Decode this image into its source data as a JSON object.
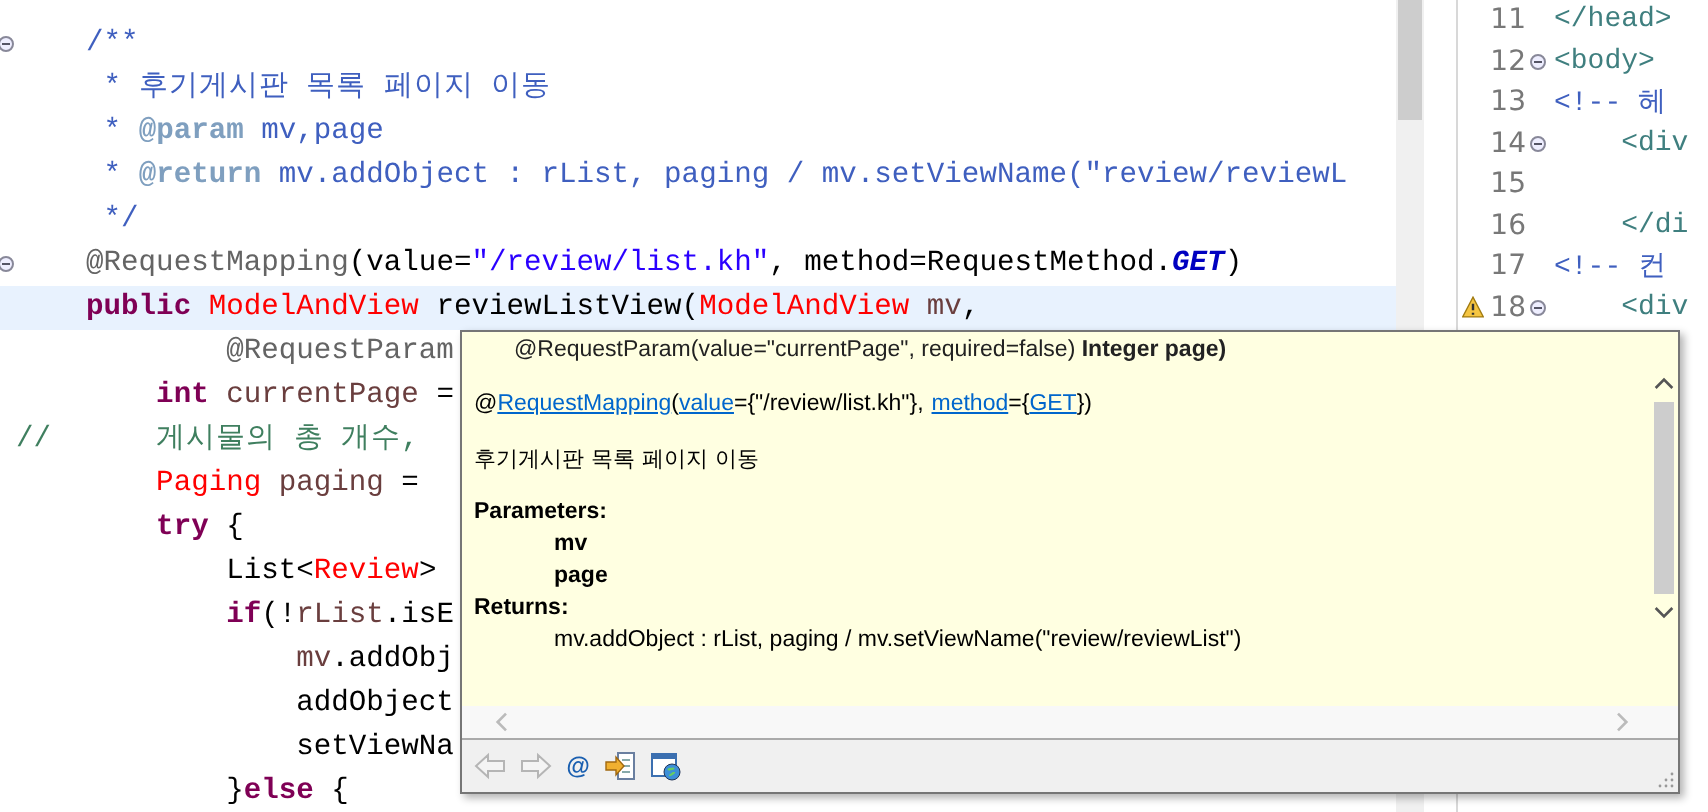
{
  "editor": {
    "lines": [
      {
        "fold": true,
        "current": false,
        "segments": [
          {
            "kind": "doc",
            "text": "    /**"
          }
        ]
      },
      {
        "fold": false,
        "current": false,
        "segments": [
          {
            "kind": "doc",
            "text": "     * 후기게시판 목록 페이지 이동"
          }
        ]
      },
      {
        "fold": false,
        "current": false,
        "segments": [
          {
            "kind": "doc",
            "text": "     * "
          },
          {
            "kind": "doctag",
            "text": "@param"
          },
          {
            "kind": "doc",
            "text": " mv,page"
          }
        ]
      },
      {
        "fold": false,
        "current": false,
        "segments": [
          {
            "kind": "doc",
            "text": "     * "
          },
          {
            "kind": "doctag",
            "text": "@return"
          },
          {
            "kind": "doc",
            "text": " mv.addObject : rList, paging / mv.setViewName(\"review/reviewL"
          }
        ]
      },
      {
        "fold": false,
        "current": false,
        "segments": [
          {
            "kind": "doc",
            "text": "     */"
          }
        ]
      },
      {
        "fold": true,
        "current": false,
        "segments": [
          {
            "kind": "annotation",
            "text": "    @RequestMapping"
          },
          {
            "kind": "plain",
            "text": "(value="
          },
          {
            "kind": "string",
            "text": "\"/review/list.kh\""
          },
          {
            "kind": "plain",
            "text": ", method=RequestMethod."
          },
          {
            "kind": "constant",
            "text": "GET"
          },
          {
            "kind": "plain",
            "text": ")"
          }
        ]
      },
      {
        "fold": false,
        "current": true,
        "segments": [
          {
            "kind": "keyword",
            "text": "    public"
          },
          {
            "kind": "type",
            "text": " ModelAndView"
          },
          {
            "kind": "plain",
            "text": " reviewListView("
          },
          {
            "kind": "type",
            "text": "ModelAndView"
          },
          {
            "kind": "var",
            "text": " mv"
          },
          {
            "kind": "plain",
            "text": ","
          }
        ]
      },
      {
        "fold": false,
        "current": false,
        "segments": [
          {
            "kind": "annotation",
            "text": "            @RequestParam"
          }
        ]
      },
      {
        "fold": false,
        "current": false,
        "segments": [
          {
            "kind": "keyword",
            "text": "        int"
          },
          {
            "kind": "var",
            "text": " currentPage"
          },
          {
            "kind": "plain",
            "text": " ="
          }
        ]
      },
      {
        "fold": false,
        "current": false,
        "segments": [
          {
            "kind": "comment",
            "text": "//      게시물의 총 개수,"
          }
        ]
      },
      {
        "fold": false,
        "current": false,
        "segments": [
          {
            "kind": "type",
            "text": "        Paging"
          },
          {
            "kind": "var",
            "text": " paging"
          },
          {
            "kind": "plain",
            "text": " ="
          }
        ]
      },
      {
        "fold": false,
        "current": false,
        "segments": [
          {
            "kind": "keyword",
            "text": "        try"
          },
          {
            "kind": "plain",
            "text": " {"
          }
        ]
      },
      {
        "fold": false,
        "current": false,
        "segments": [
          {
            "kind": "plain",
            "text": "            List<"
          },
          {
            "kind": "type",
            "text": "Review"
          },
          {
            "kind": "plain",
            "text": ">"
          }
        ]
      },
      {
        "fold": false,
        "current": false,
        "segments": [
          {
            "kind": "keyword",
            "text": "            if"
          },
          {
            "kind": "plain",
            "text": "(!"
          },
          {
            "kind": "var",
            "text": "rList"
          },
          {
            "kind": "plain",
            "text": ".isE"
          }
        ]
      },
      {
        "fold": false,
        "current": false,
        "segments": [
          {
            "kind": "var",
            "text": "                mv"
          },
          {
            "kind": "plain",
            "text": ".addObj"
          }
        ]
      },
      {
        "fold": false,
        "current": false,
        "segments": [
          {
            "kind": "plain",
            "text": "                addObject"
          }
        ]
      },
      {
        "fold": false,
        "current": false,
        "segments": [
          {
            "kind": "plain",
            "text": "                setViewNa"
          }
        ]
      },
      {
        "fold": false,
        "current": false,
        "segments": [
          {
            "kind": "plain",
            "text": "            }"
          },
          {
            "kind": "keyword",
            "text": "else"
          },
          {
            "kind": "plain",
            "text": " {"
          }
        ]
      }
    ]
  },
  "html_editor": {
    "lines": [
      {
        "number": "11",
        "fold": false,
        "warning": false,
        "segments": [
          {
            "kind": "tag",
            "text": "</head>"
          }
        ]
      },
      {
        "number": "12",
        "fold": true,
        "warning": false,
        "segments": [
          {
            "kind": "tag",
            "text": "<body>"
          }
        ]
      },
      {
        "number": "13",
        "fold": false,
        "warning": false,
        "segments": [
          {
            "kind": "comment",
            "text": "<!-- 헤"
          }
        ]
      },
      {
        "number": "14",
        "fold": true,
        "warning": false,
        "segments": [
          {
            "kind": "tag",
            "text": "    <div"
          }
        ]
      },
      {
        "number": "15",
        "fold": false,
        "warning": false
      },
      {
        "number": "16",
        "fold": false,
        "warning": false,
        "segments": [
          {
            "kind": "tag",
            "text": "    </di"
          }
        ]
      },
      {
        "number": "17",
        "fold": false,
        "warning": false,
        "segments": [
          {
            "kind": "comment",
            "text": "<!-- 컨"
          }
        ]
      },
      {
        "number": "18",
        "fold": true,
        "warning": true,
        "segments": [
          {
            "kind": "tag",
            "text": "    <div"
          }
        ]
      }
    ]
  },
  "hover_popup": {
    "signature_tail": "@RequestParam(value=\"currentPage\", required=false) **Integer page)**",
    "annotation": [
      {
        "link": false,
        "text": "@"
      },
      {
        "link": true,
        "text": "RequestMapping"
      },
      {
        "link": false,
        "text": "("
      },
      {
        "link": true,
        "text": "value"
      },
      {
        "link": false,
        "text": "={\"/review/list.kh\"},"
      },
      {
        "link": true,
        "text": "method"
      },
      {
        "link": false,
        "text": "={"
      },
      {
        "link": true,
        "text": "GET"
      },
      {
        "link": false,
        "text": "})"
      }
    ],
    "description": "후기게시판 목록 페이지 이동",
    "sections": [
      {
        "heading": "Parameters:",
        "items": [
          {
            "text": "mv",
            "bold": true
          },
          {
            "text": "page",
            "bold": true
          }
        ]
      },
      {
        "heading": "Returns:",
        "items": [
          {
            "text": "mv.addObject : rList, paging / mv.setViewName(\"review/reviewList\")",
            "bold": false
          }
        ]
      }
    ],
    "toolbar": [
      {
        "kind": "back",
        "disabled": true
      },
      {
        "kind": "forward",
        "disabled": true
      },
      {
        "kind": "at",
        "text": "@",
        "disabled": false
      },
      {
        "kind": "open-declaration",
        "disabled": false
      },
      {
        "kind": "browser",
        "disabled": false
      }
    ]
  }
}
